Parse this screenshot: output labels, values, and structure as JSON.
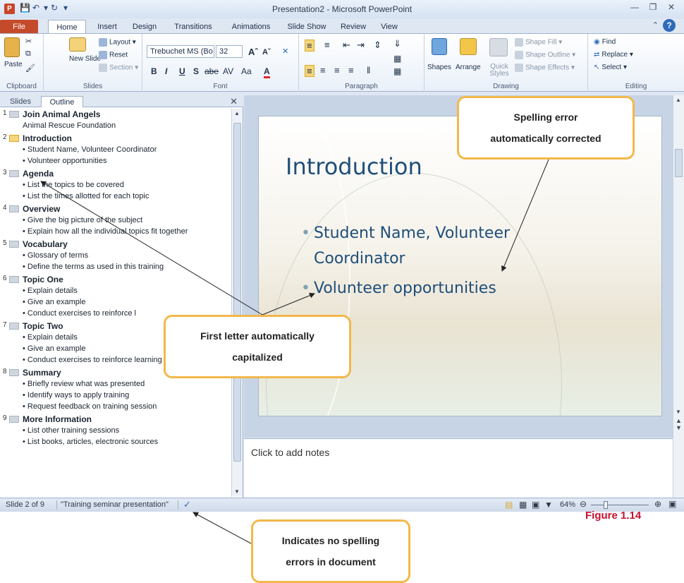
{
  "window": {
    "title": "Presentation2 - Microsoft PowerPoint",
    "app_icon": "P"
  },
  "tabs": [
    "File",
    "Home",
    "Insert",
    "Design",
    "Transitions",
    "Animations",
    "Slide Show",
    "Review",
    "View"
  ],
  "active_tab": "Home",
  "ribbon": {
    "clipboard": {
      "paste": "Paste",
      "label": "Clipboard"
    },
    "slides": {
      "new_slide": "New Slide",
      "layout": "Layout",
      "reset": "Reset",
      "section": "Section",
      "label": "Slides"
    },
    "font": {
      "family": "Trebuchet MS (Bo",
      "size": "32",
      "bold": "B",
      "italic": "I",
      "underline": "U",
      "shadow": "S",
      "strike": "abe",
      "spacing": "AV",
      "case": "Aa",
      "color": "A",
      "label": "Font"
    },
    "paragraph": {
      "label": "Paragraph"
    },
    "drawing": {
      "shapes": "Shapes",
      "arrange": "Arrange",
      "quick_styles": "Quick Styles",
      "shape_fill": "Shape Fill",
      "shape_outline": "Shape Outline",
      "shape_effects": "Shape Effects",
      "label": "Drawing"
    },
    "editing": {
      "find": "Find",
      "replace": "Replace",
      "select": "Select",
      "label": "Editing"
    }
  },
  "left_pane": {
    "tabs": [
      "Slides",
      "Outline"
    ],
    "active": "Outline",
    "slides": [
      {
        "num": "1",
        "title": "Join Animal Angels",
        "lines": [
          "Animal Rescue Foundation"
        ],
        "bullets": false,
        "selected": false
      },
      {
        "num": "2",
        "title": "Introduction",
        "lines": [
          "Student Name, Volunteer Coordinator",
          "Volunteer opportunities"
        ],
        "bullets": true,
        "selected": true
      },
      {
        "num": "3",
        "title": "Agenda",
        "lines": [
          "List the topics to be covered",
          "List the times allotted for each topic"
        ],
        "bullets": true,
        "selected": false
      },
      {
        "num": "4",
        "title": "Overview",
        "lines": [
          "Give the big picture of the subject",
          "Explain how all the individual topics fit together"
        ],
        "bullets": true,
        "selected": false
      },
      {
        "num": "5",
        "title": "Vocabulary",
        "lines": [
          "Glossary of terms",
          "Define the terms as used in this training"
        ],
        "bullets": true,
        "selected": false
      },
      {
        "num": "6",
        "title": "Topic One",
        "lines": [
          "Explain details",
          "Give an example",
          "Conduct exercises to reinforce l"
        ],
        "bullets": true,
        "selected": false
      },
      {
        "num": "7",
        "title": "Topic Two",
        "lines": [
          "Explain details",
          "Give an example",
          "Conduct exercises to reinforce learning"
        ],
        "bullets": true,
        "selected": false
      },
      {
        "num": "8",
        "title": "Summary",
        "lines": [
          "Briefly review what was presented",
          "Identify ways to apply training",
          "Request feedback on training session"
        ],
        "bullets": true,
        "selected": false
      },
      {
        "num": "9",
        "title": "More Information",
        "lines": [
          "List other training sessions",
          "List books, articles, electronic sources"
        ],
        "bullets": true,
        "selected": false
      }
    ]
  },
  "slide": {
    "title": "Introduction",
    "bullet1_line1": "Student Name, Volunteer",
    "bullet1_line2": "Coordinator",
    "bullet2": "Volunteer opportunities"
  },
  "notes": {
    "placeholder": "Click to add notes"
  },
  "status": {
    "slide_info": "Slide 2 of 9",
    "theme": "\"Training seminar presentation\"",
    "zoom": "64%"
  },
  "callouts": {
    "spelling": {
      "line1": "Spelling error",
      "line2": "automatically corrected"
    },
    "capital": {
      "line1": "First letter automatically",
      "line2": "capitalized"
    },
    "proof": {
      "line1": "Indicates no spelling",
      "line2": "errors in document"
    }
  },
  "figure_label": "Figure 1.14",
  "colors": {
    "accent": "#c54a2b",
    "callout_border": "#f2b84b",
    "figure_label": "#c8102e",
    "slide_text": "#1f4e79"
  }
}
